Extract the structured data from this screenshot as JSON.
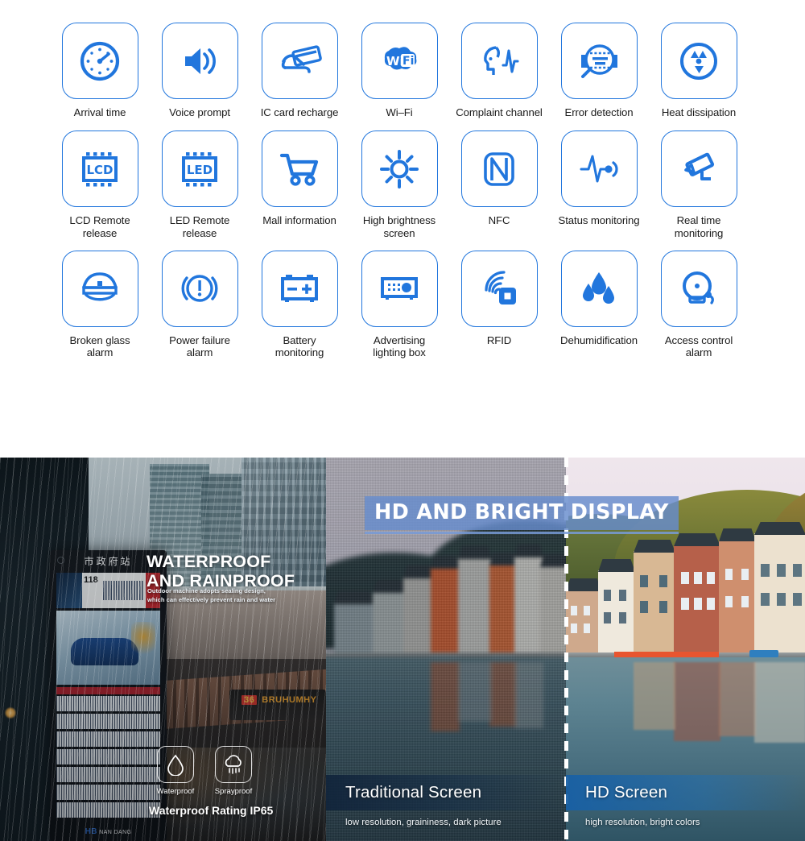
{
  "features": {
    "rows": [
      [
        {
          "icon": "gauge-dashboard-icon",
          "label": "Arrival time"
        },
        {
          "icon": "speaker-volume-icon",
          "label": "Voice prompt"
        },
        {
          "icon": "hand-card-swipe-icon",
          "label": "IC card recharge"
        },
        {
          "icon": "wifi-cloud-icon",
          "label": "Wi–Fi"
        },
        {
          "icon": "face-voice-wave-icon",
          "label": "Complaint channel"
        },
        {
          "icon": "magnifier-inspect-icon",
          "label": "Error detection"
        },
        {
          "icon": "radiation-fan-icon",
          "label": "Heat dissipation"
        }
      ],
      [
        {
          "icon": "lcd-chip-icon",
          "label": "LCD Remote\nrelease"
        },
        {
          "icon": "led-chip-icon",
          "label": "LED Remote\nrelease"
        },
        {
          "icon": "shopping-cart-icon",
          "label": "Mall information"
        },
        {
          "icon": "sun-brightness-icon",
          "label": "High brightness\nscreen"
        },
        {
          "icon": "nfc-icon",
          "label": "NFC"
        },
        {
          "icon": "pulse-monitor-icon",
          "label": "Status monitoring"
        },
        {
          "icon": "cctv-camera-icon",
          "label": "Real time\nmonitoring"
        }
      ],
      [
        {
          "icon": "police-cap-icon",
          "label": "Broken glass\nalarm"
        },
        {
          "icon": "power-warning-icon",
          "label": "Power failure\nalarm"
        },
        {
          "icon": "battery-icon",
          "label": "Battery\nmonitoring"
        },
        {
          "icon": "light-box-icon",
          "label": "Advertising\nlighting box"
        },
        {
          "icon": "rfid-signal-icon",
          "label": "RFID"
        },
        {
          "icon": "water-drops-icon",
          "label": "Dehumidification"
        },
        {
          "icon": "alarm-bell-icon",
          "label": "Access control\nalarm"
        }
      ]
    ],
    "accent_color": "#2176dd",
    "label_color": "#1a1a1a"
  },
  "waterproof_panel": {
    "title": "WATERPROOF\nAND RAINPROOF",
    "subtitle": "Outdoor machine adopts sealing design,\nwhich can effectively prevent rain and water",
    "kiosk": {
      "station_name": "市政府站",
      "route_number": "118",
      "brand": "NAN DANG"
    },
    "bus_sign": {
      "number": "36",
      "destination": "BRUHUMHY"
    },
    "badges": [
      {
        "icon": "water-drop-outline-icon",
        "label": "Waterproof"
      },
      {
        "icon": "rain-cloud-outline-icon",
        "label": "Sprayproof"
      }
    ],
    "rating": "Waterproof Rating IP65"
  },
  "hd_panel": {
    "title": "HD AND BRIGHT DISPLAY",
    "title_highlight_color": "#678CCD",
    "comparison": [
      {
        "name": "Traditional Screen",
        "description": "low resolution, graininess, dark picture",
        "bar_color": "#11243B"
      },
      {
        "name": "HD Screen",
        "description": "high resolution, bright colors",
        "bar_color": "#1860A5"
      }
    ],
    "divider_style": "dashed-white-vertical"
  }
}
